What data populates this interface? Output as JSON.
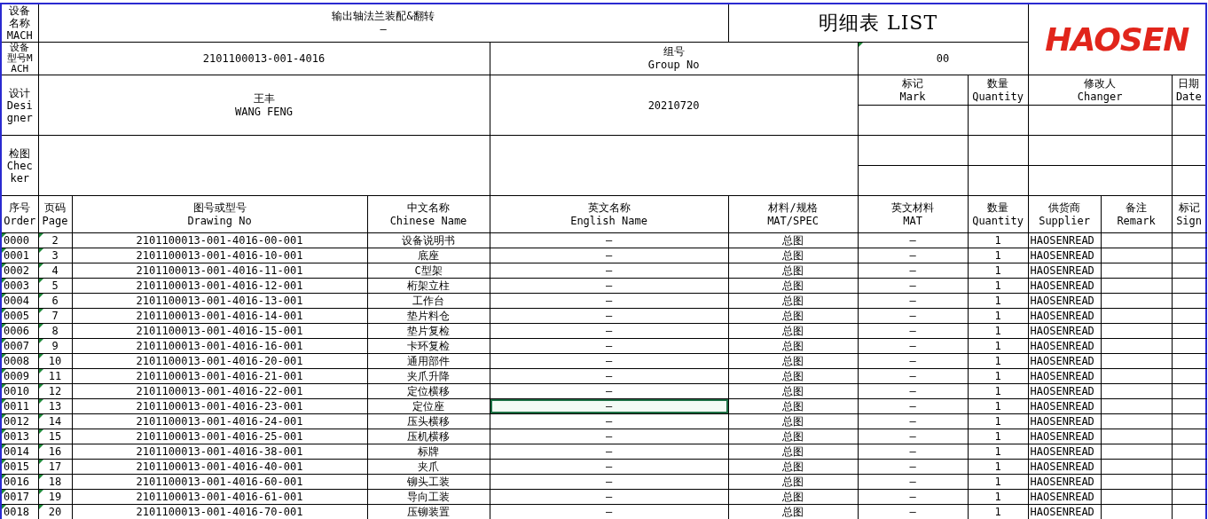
{
  "sheet": {
    "device_name_label": "设备名称MACH",
    "device_name": "输出轴法兰装配&翻转",
    "device_name_sub": "–",
    "title": "明细表 LIST",
    "logo": "HAOSEN",
    "device_model_label": "设备型号MACH",
    "device_model": "2101100013-001-4016",
    "group_label_zh": "组号",
    "group_label_en": "Group No",
    "group_no": "00",
    "designer_label": "设计Designer",
    "designer_zh": "王丰",
    "designer_en": "WANG FENG",
    "date_value": "20210720",
    "checker_label": "检图Checker",
    "revision_columns": [
      {
        "zh": "标记",
        "en": "Mark"
      },
      {
        "zh": "数量",
        "en": "Quantity"
      },
      {
        "zh": "修改人",
        "en": "Changer"
      },
      {
        "zh": "日期",
        "en": "Date"
      }
    ]
  },
  "table": {
    "columns": [
      {
        "zh": "序号",
        "en": "Order"
      },
      {
        "zh": "页码",
        "en": "Page"
      },
      {
        "zh": "图号或型号",
        "en": "Drawing No"
      },
      {
        "zh": "中文名称",
        "en": "Chinese Name"
      },
      {
        "zh": "英文名称",
        "en": "English Name"
      },
      {
        "zh": "材料/规格",
        "en": "MAT/SPEC"
      },
      {
        "zh": "英文材料",
        "en": "MAT"
      },
      {
        "zh": "数量",
        "en": "Quantity"
      },
      {
        "zh": "供货商",
        "en": "Supplier"
      },
      {
        "zh": "备注",
        "en": "Remark"
      },
      {
        "zh": "标记",
        "en": "Sign"
      }
    ],
    "rows": [
      {
        "order": "0000",
        "page": "2",
        "drawing_no": "2101100013-001-4016-00-001",
        "chinese_name": "设备说明书",
        "english_name": "–",
        "mat_spec": "总图",
        "english_mat": "–",
        "quantity": "1",
        "supplier": "HAOSENREAD",
        "selected": false
      },
      {
        "order": "0001",
        "page": "3",
        "drawing_no": "2101100013-001-4016-10-001",
        "chinese_name": "底座",
        "english_name": "–",
        "mat_spec": "总图",
        "english_mat": "–",
        "quantity": "1",
        "supplier": "HAOSENREAD",
        "selected": false
      },
      {
        "order": "0002",
        "page": "4",
        "drawing_no": "2101100013-001-4016-11-001",
        "chinese_name": "C型架",
        "english_name": "–",
        "mat_spec": "总图",
        "english_mat": "–",
        "quantity": "1",
        "supplier": "HAOSENREAD",
        "selected": false
      },
      {
        "order": "0003",
        "page": "5",
        "drawing_no": "2101100013-001-4016-12-001",
        "chinese_name": "桁架立柱",
        "english_name": "–",
        "mat_spec": "总图",
        "english_mat": "–",
        "quantity": "1",
        "supplier": "HAOSENREAD",
        "selected": false
      },
      {
        "order": "0004",
        "page": "6",
        "drawing_no": "2101100013-001-4016-13-001",
        "chinese_name": "工作台",
        "english_name": "–",
        "mat_spec": "总图",
        "english_mat": "–",
        "quantity": "1",
        "supplier": "HAOSENREAD",
        "selected": false
      },
      {
        "order": "0005",
        "page": "7",
        "drawing_no": "2101100013-001-4016-14-001",
        "chinese_name": "垫片料仓",
        "english_name": "–",
        "mat_spec": "总图",
        "english_mat": "–",
        "quantity": "1",
        "supplier": "HAOSENREAD",
        "selected": false
      },
      {
        "order": "0006",
        "page": "8",
        "drawing_no": "2101100013-001-4016-15-001",
        "chinese_name": "垫片复检",
        "english_name": "–",
        "mat_spec": "总图",
        "english_mat": "–",
        "quantity": "1",
        "supplier": "HAOSENREAD",
        "selected": false
      },
      {
        "order": "0007",
        "page": "9",
        "drawing_no": "2101100013-001-4016-16-001",
        "chinese_name": "卡环复检",
        "english_name": "–",
        "mat_spec": "总图",
        "english_mat": "–",
        "quantity": "1",
        "supplier": "HAOSENREAD",
        "selected": false
      },
      {
        "order": "0008",
        "page": "10",
        "drawing_no": "2101100013-001-4016-20-001",
        "chinese_name": "通用部件",
        "english_name": "–",
        "mat_spec": "总图",
        "english_mat": "–",
        "quantity": "1",
        "supplier": "HAOSENREAD",
        "selected": false
      },
      {
        "order": "0009",
        "page": "11",
        "drawing_no": "2101100013-001-4016-21-001",
        "chinese_name": "夹爪升降",
        "english_name": "–",
        "mat_spec": "总图",
        "english_mat": "–",
        "quantity": "1",
        "supplier": "HAOSENREAD",
        "selected": false
      },
      {
        "order": "0010",
        "page": "12",
        "drawing_no": "2101100013-001-4016-22-001",
        "chinese_name": "定位横移",
        "english_name": "–",
        "mat_spec": "总图",
        "english_mat": "–",
        "quantity": "1",
        "supplier": "HAOSENREAD",
        "selected": false
      },
      {
        "order": "0011",
        "page": "13",
        "drawing_no": "2101100013-001-4016-23-001",
        "chinese_name": "定位座",
        "english_name": "–",
        "mat_spec": "总图",
        "english_mat": "–",
        "quantity": "1",
        "supplier": "HAOSENREAD",
        "selected": true
      },
      {
        "order": "0012",
        "page": "14",
        "drawing_no": "2101100013-001-4016-24-001",
        "chinese_name": "压头横移",
        "english_name": "–",
        "mat_spec": "总图",
        "english_mat": "–",
        "quantity": "1",
        "supplier": "HAOSENREAD",
        "selected": false
      },
      {
        "order": "0013",
        "page": "15",
        "drawing_no": "2101100013-001-4016-25-001",
        "chinese_name": "压机横移",
        "english_name": "–",
        "mat_spec": "总图",
        "english_mat": "–",
        "quantity": "1",
        "supplier": "HAOSENREAD",
        "selected": false
      },
      {
        "order": "0014",
        "page": "16",
        "drawing_no": "2101100013-001-4016-38-001",
        "chinese_name": "标牌",
        "english_name": "–",
        "mat_spec": "总图",
        "english_mat": "–",
        "quantity": "1",
        "supplier": "HAOSENREAD",
        "selected": false
      },
      {
        "order": "0015",
        "page": "17",
        "drawing_no": "2101100013-001-4016-40-001",
        "chinese_name": "夹爪",
        "english_name": "–",
        "mat_spec": "总图",
        "english_mat": "–",
        "quantity": "1",
        "supplier": "HAOSENREAD",
        "selected": false
      },
      {
        "order": "0016",
        "page": "18",
        "drawing_no": "2101100013-001-4016-60-001",
        "chinese_name": "铆头工装",
        "english_name": "–",
        "mat_spec": "总图",
        "english_mat": "–",
        "quantity": "1",
        "supplier": "HAOSENREAD",
        "selected": false
      },
      {
        "order": "0017",
        "page": "19",
        "drawing_no": "2101100013-001-4016-61-001",
        "chinese_name": "导向工装",
        "english_name": "–",
        "mat_spec": "总图",
        "english_mat": "–",
        "quantity": "1",
        "supplier": "HAOSENREAD",
        "selected": false
      },
      {
        "order": "0018",
        "page": "20",
        "drawing_no": "2101100013-001-4016-70-001",
        "chinese_name": "压铆装置",
        "english_name": "–",
        "mat_spec": "总图",
        "english_mat": "–",
        "quantity": "1",
        "supplier": "HAOSENREAD",
        "selected": false
      }
    ]
  }
}
